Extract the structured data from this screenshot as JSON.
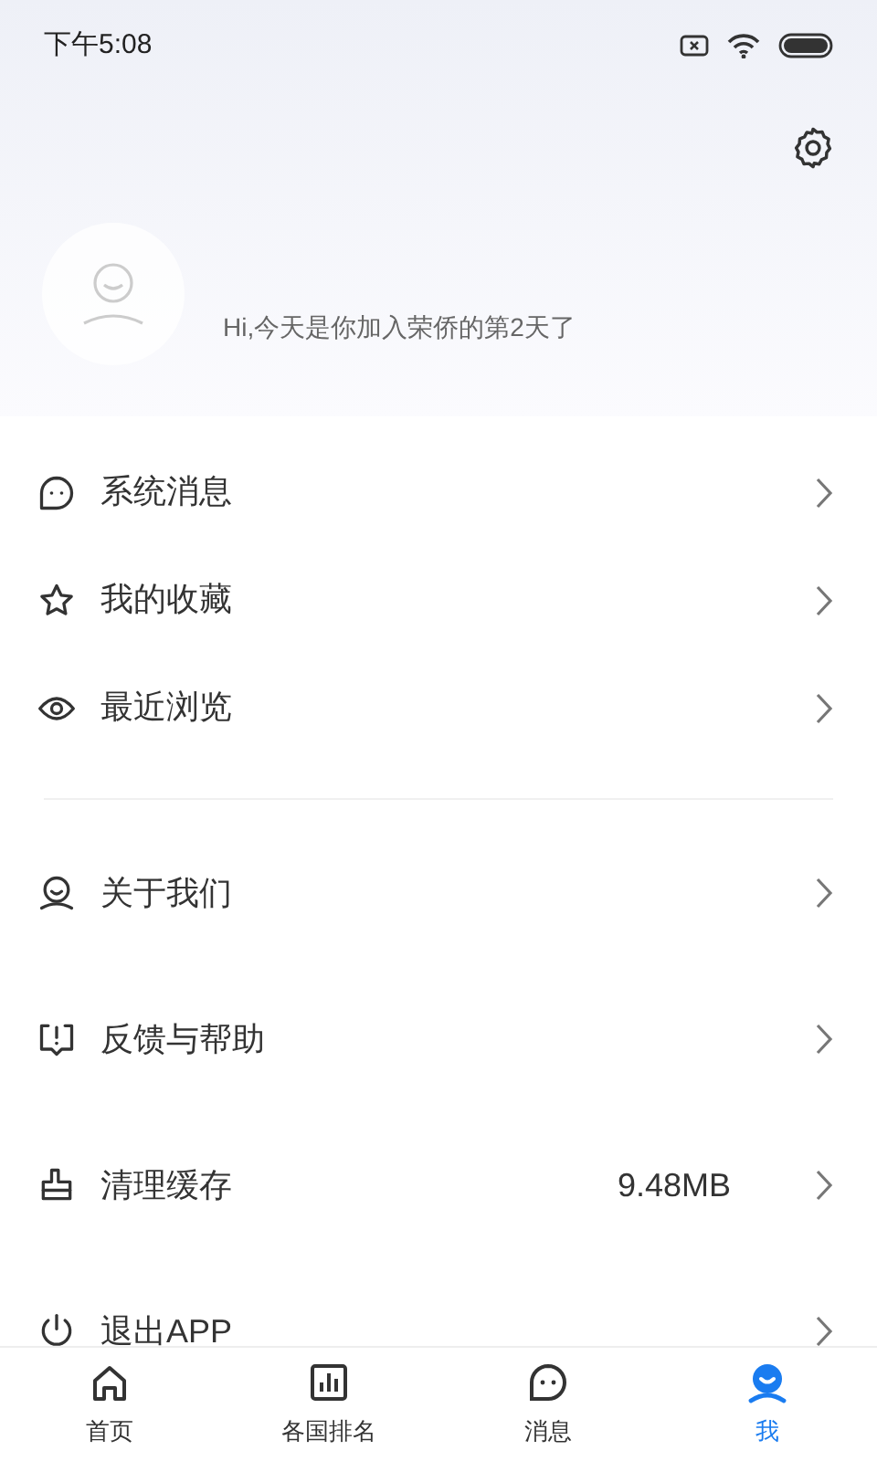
{
  "status_bar": {
    "time": "下午5:08"
  },
  "profile": {
    "greeting": "Hi,今天是你加入荣侨的第2天了"
  },
  "menu_groups": [
    {
      "items": [
        {
          "label": "系统消息"
        },
        {
          "label": "我的收藏"
        },
        {
          "label": "最近浏览"
        }
      ]
    },
    {
      "items": [
        {
          "label": "关于我们"
        },
        {
          "label": "反馈与帮助"
        },
        {
          "label": "清理缓存",
          "value": "9.48MB"
        },
        {
          "label": "退出APP"
        }
      ]
    }
  ],
  "tabs": [
    {
      "label": "首页",
      "selected": false
    },
    {
      "label": "各国排名",
      "selected": false
    },
    {
      "label": "消息",
      "selected": false
    },
    {
      "label": "我",
      "selected": true
    }
  ]
}
